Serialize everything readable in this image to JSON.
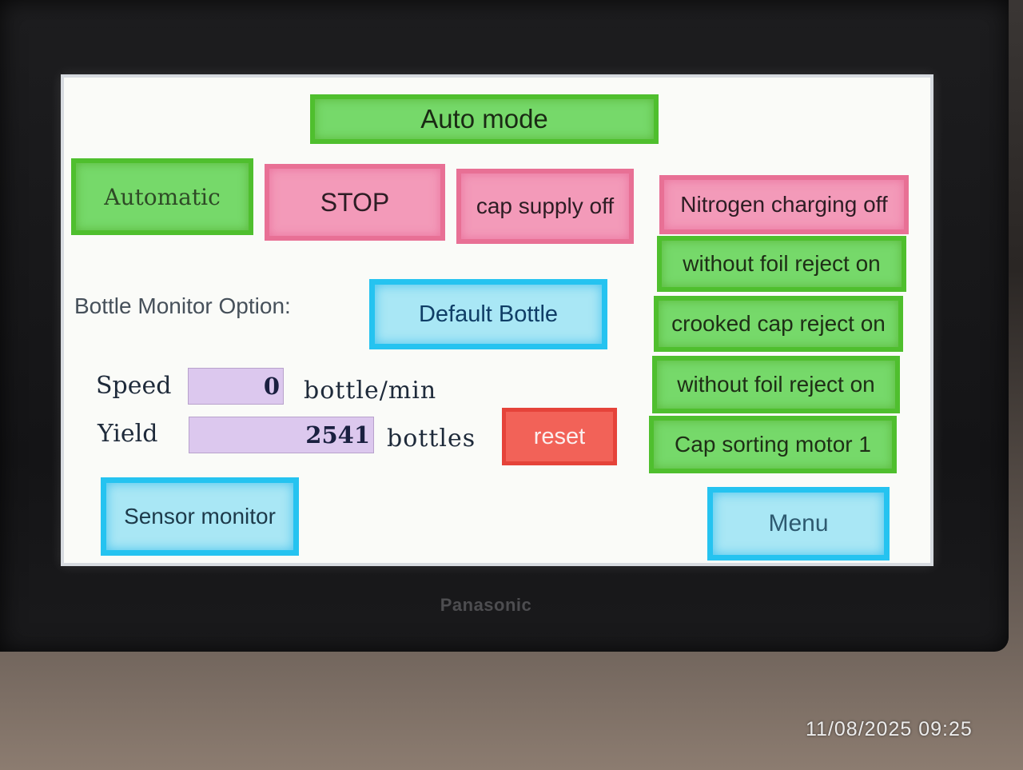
{
  "header": {
    "mode_label": "Auto mode"
  },
  "controls": {
    "automatic_label": "Automatic",
    "stop_label": "STOP",
    "cap_supply_label": "cap supply off",
    "nitrogen_label": "Nitrogen charging off",
    "foil_reject_1_label": "without foil reject on",
    "crooked_cap_label": "crooked cap reject on",
    "foil_reject_2_label": "without foil reject on",
    "cap_sorting_label": "Cap sorting motor 1"
  },
  "bottle_monitor": {
    "label": "Bottle Monitor Option:",
    "option_label": "Default Bottle"
  },
  "stats": {
    "speed_label": "Speed",
    "speed_value": "0",
    "speed_unit": "bottle/min",
    "yield_label": "Yield",
    "yield_value": "2541",
    "yield_unit": "bottles",
    "reset_label": "reset"
  },
  "nav": {
    "sensor_monitor_label": "Sensor monitor",
    "menu_label": "Menu"
  },
  "device": {
    "brand": "Panasonic",
    "timestamp": "11/08/2025 09:25"
  },
  "colors": {
    "green": "#76d96a",
    "pink": "#f39ab9",
    "cyan": "#25c3f0",
    "red": "#f26258",
    "field": "#dcc8ee"
  }
}
